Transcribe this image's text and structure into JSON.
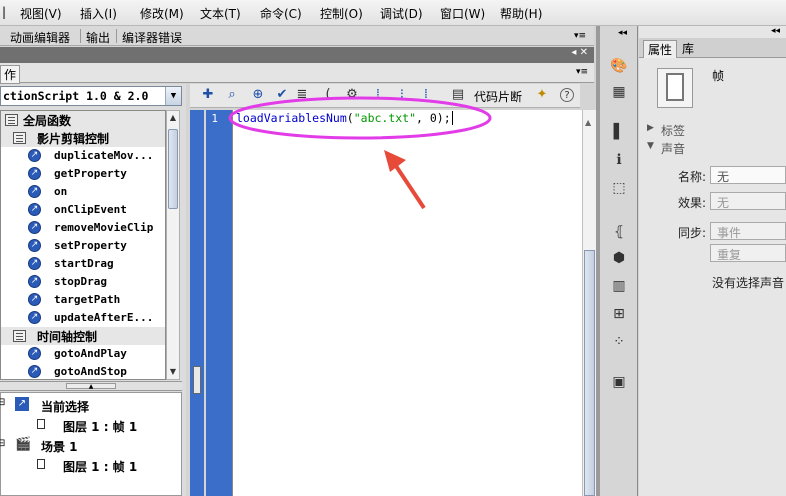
{
  "menu": [
    "视图(V)",
    "插入(I)",
    "修改(M)",
    "文本(T)",
    "命令(C)",
    "控制(O)",
    "调试(D)",
    "窗口(W)",
    "帮助(H)"
  ],
  "panel_tabs": [
    "动画编辑器",
    "输出",
    "编译器错误"
  ],
  "actions_tab_label": "作",
  "as_version": "ctionScript 1.0 & 2.0",
  "tree": {
    "global_functions": "全局函数",
    "movieclip_category": "影片剪辑控制",
    "movieclip_items": [
      "duplicateMov...",
      "getProperty",
      "on",
      "onClipEvent",
      "removeMovieClip",
      "setProperty",
      "startDrag",
      "stopDrag",
      "targetPath",
      "updateAfterE..."
    ],
    "timeline_category": "时间轴控制",
    "timeline_items": [
      "gotoAndPlay",
      "gotoAndStop"
    ]
  },
  "selection_tree": {
    "current_selection": "当前选择",
    "layer_frame_1": "图层 1 : 帧 1",
    "scene": "场景 1",
    "layer_frame_2": "图层 1 : 帧 1"
  },
  "editor": {
    "snippet_label": "代码片断",
    "line_number": "1",
    "code_fn": "loadVariablesNum",
    "code_open": "(",
    "code_str": "\"abc.txt\"",
    "code_rest": ", 0);"
  },
  "props": {
    "tab_properties": "属性",
    "tab_library": "库",
    "frame_label": "帧",
    "section_label": "标签",
    "section_sound": "声音",
    "name_label": "名称:",
    "name_value": "无",
    "effect_label": "效果:",
    "effect_value": "无",
    "sync_label": "同步:",
    "sync_value": "事件",
    "repeat_value": "重复",
    "no_sound_text": "没有选择声音"
  },
  "colors": {
    "annotation": "#e23ce8",
    "arrow": "#e84a3a",
    "gutter": "#3a6ec8"
  }
}
